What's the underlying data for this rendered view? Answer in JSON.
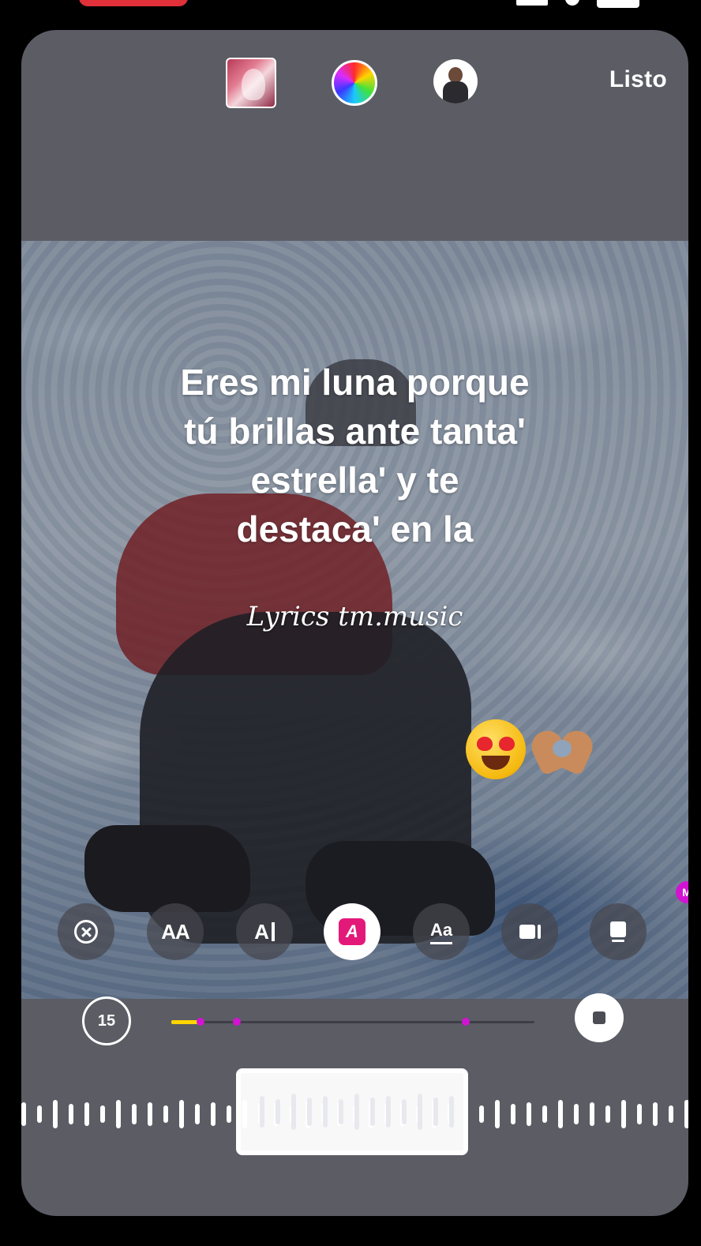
{
  "header": {
    "done_label": "Listo",
    "icons": [
      "album-cover-thumbnail",
      "color-wheel-icon",
      "profile-avatar"
    ]
  },
  "canvas": {
    "lyrics_lines": [
      "Eres mi luna porque",
      "tú brillas ante tanta'",
      "estrella' y te",
      "destaca' en la"
    ],
    "credit_text": "Lyrics tm.music",
    "stickers": [
      "heart-eyes-emoji",
      "heart-hands-emoji"
    ]
  },
  "style_buttons": [
    {
      "name": "close",
      "icon": "close-circle-icon"
    },
    {
      "name": "text-size",
      "label": "AA"
    },
    {
      "name": "text-cursor",
      "label": "A"
    },
    {
      "name": "highlight",
      "label": "A",
      "active": true
    },
    {
      "name": "text-style",
      "label": "Aa"
    },
    {
      "name": "video-mode",
      "icon": "video-camera-icon"
    },
    {
      "name": "card-mode",
      "icon": "card-icon"
    }
  ],
  "edge_badge": "M",
  "timeline": {
    "duration": "15",
    "progress_fraction": 0.08,
    "marker_fractions": [
      0.08,
      0.18,
      0.81
    ]
  },
  "colors": {
    "accent_pink": "#e3197a",
    "marker_magenta": "#d214d2",
    "progress_yellow": "#ffd500",
    "sheet_gray": "#5b5c64"
  }
}
